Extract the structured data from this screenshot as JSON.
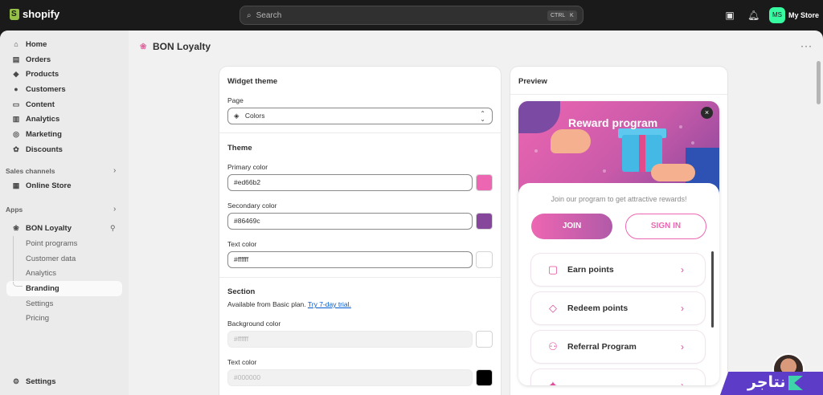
{
  "topbar": {
    "brand": "shopify",
    "search_placeholder": "Search",
    "kbd_ctrl": "CTRL",
    "kbd_k": "K",
    "store_initials": "MS",
    "store_name": "My Store"
  },
  "sidebar": {
    "items": [
      {
        "label": "Home",
        "icon": "home-icon"
      },
      {
        "label": "Orders",
        "icon": "orders-icon"
      },
      {
        "label": "Products",
        "icon": "tag-icon"
      },
      {
        "label": "Customers",
        "icon": "person-icon"
      },
      {
        "label": "Content",
        "icon": "content-icon"
      },
      {
        "label": "Analytics",
        "icon": "analytics-icon"
      },
      {
        "label": "Marketing",
        "icon": "marketing-icon"
      },
      {
        "label": "Discounts",
        "icon": "discount-icon"
      }
    ],
    "sales_channels_label": "Sales channels",
    "online_store": "Online Store",
    "apps_label": "Apps",
    "app_name": "BON Loyalty",
    "app_sub": [
      "Point programs",
      "Customer data",
      "Analytics",
      "Branding",
      "Settings",
      "Pricing"
    ],
    "active_sub": "Branding",
    "settings": "Settings"
  },
  "header": {
    "title": "BON Loyalty"
  },
  "widget_theme": {
    "title": "Widget theme",
    "page_label": "Page",
    "page_value": "Colors",
    "theme_title": "Theme",
    "primary_label": "Primary color",
    "primary_value": "#ed66b2",
    "secondary_label": "Secondary color",
    "secondary_value": "#86469c",
    "text_label": "Text color",
    "text_value": "#ffffff",
    "section_title": "Section",
    "section_note": "Available from Basic plan.",
    "section_link": "Try 7-day trial.",
    "bg_label": "Background color",
    "bg_value": "#ffffff",
    "section_text_label": "Text color",
    "section_text_value": "#000000"
  },
  "preview": {
    "title": "Preview",
    "banner_title": "Reward program",
    "close": "×",
    "join_text": "Join our program to get attractive rewards!",
    "join_btn": "JOIN",
    "sign_btn": "SIGN IN",
    "options": [
      {
        "label": "Earn points",
        "icon": "wallet-icon"
      },
      {
        "label": "Redeem points",
        "icon": "ticket-icon"
      },
      {
        "label": "Referral Program",
        "icon": "users-icon"
      },
      {
        "label": "",
        "icon": "gift-icon"
      }
    ]
  },
  "colors": {
    "primary": "#ed66b2",
    "secondary": "#86469c",
    "text": "#ffffff",
    "section_bg": "#ffffff",
    "section_text": "#000000"
  },
  "overlay": {
    "brand_text": "نتاجر"
  }
}
